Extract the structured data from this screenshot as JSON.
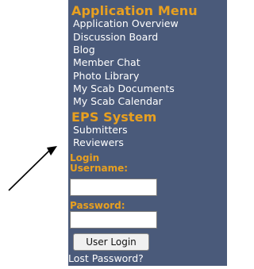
{
  "menu": {
    "application_heading": "Application Menu",
    "application_items": [
      "Application Overview",
      "Discussion Board",
      "Blog",
      "Member Chat",
      "Photo Library",
      "My Scab Documents",
      "My Scab Calendar"
    ],
    "eps_heading": "EPS System",
    "eps_items": [
      "Submitters",
      "Reviewers"
    ]
  },
  "login": {
    "heading": "Login",
    "username_label": "Username:",
    "username_value": "",
    "password_label": "Password:",
    "password_value": "",
    "button_label": "User Login",
    "lost_password": "Lost Password?"
  },
  "colors": {
    "panel_bg": "#4a5a7a",
    "heading_orange": "#e8a020",
    "text_white": "#ffffff"
  }
}
